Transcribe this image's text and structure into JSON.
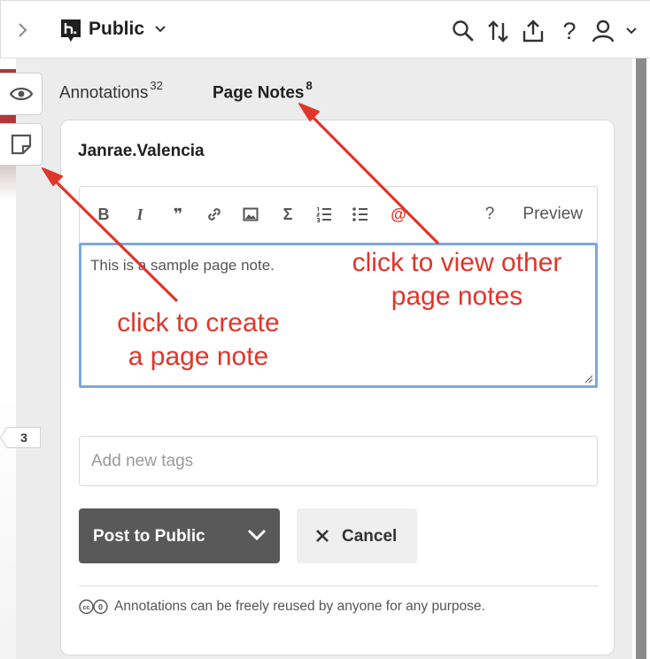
{
  "topbar": {
    "group_name": "Public",
    "logo": "hypothesis-logo",
    "icons": [
      "chevron-right-icon",
      "search-icon",
      "sort-icon",
      "share-icon",
      "help-icon",
      "user-icon",
      "chevron-down-icon"
    ]
  },
  "sidebar_tabs": {
    "annotations_label": "Annotations",
    "annotations_count": "32",
    "page_notes_label": "Page Notes",
    "page_notes_count": "8"
  },
  "side_buttons": {
    "show_highlights_icon": "eye-icon",
    "new_page_note_icon": "note-icon"
  },
  "bucket_count": "3",
  "card": {
    "username": "Janrae.Valencia",
    "toolbar": {
      "bold": "B",
      "italic": "I",
      "quote": "❞",
      "sigma": "Σ",
      "mention": "@",
      "help": "?",
      "preview_label": "Preview"
    },
    "note_text": "This is a sample page note.",
    "tags_placeholder": "Add new tags",
    "post_label": "Post to Public",
    "cancel_label": "Cancel",
    "license_text": "Annotations can be freely reused by anyone for any purpose."
  },
  "callouts": {
    "create_line1": "click to create",
    "create_line2": "a page note",
    "view_line1": "click to view other",
    "view_line2": "page notes"
  },
  "colors": {
    "accent_red": "#e1352a",
    "button_dark": "#595959",
    "focus_blue": "#7fa7db"
  }
}
